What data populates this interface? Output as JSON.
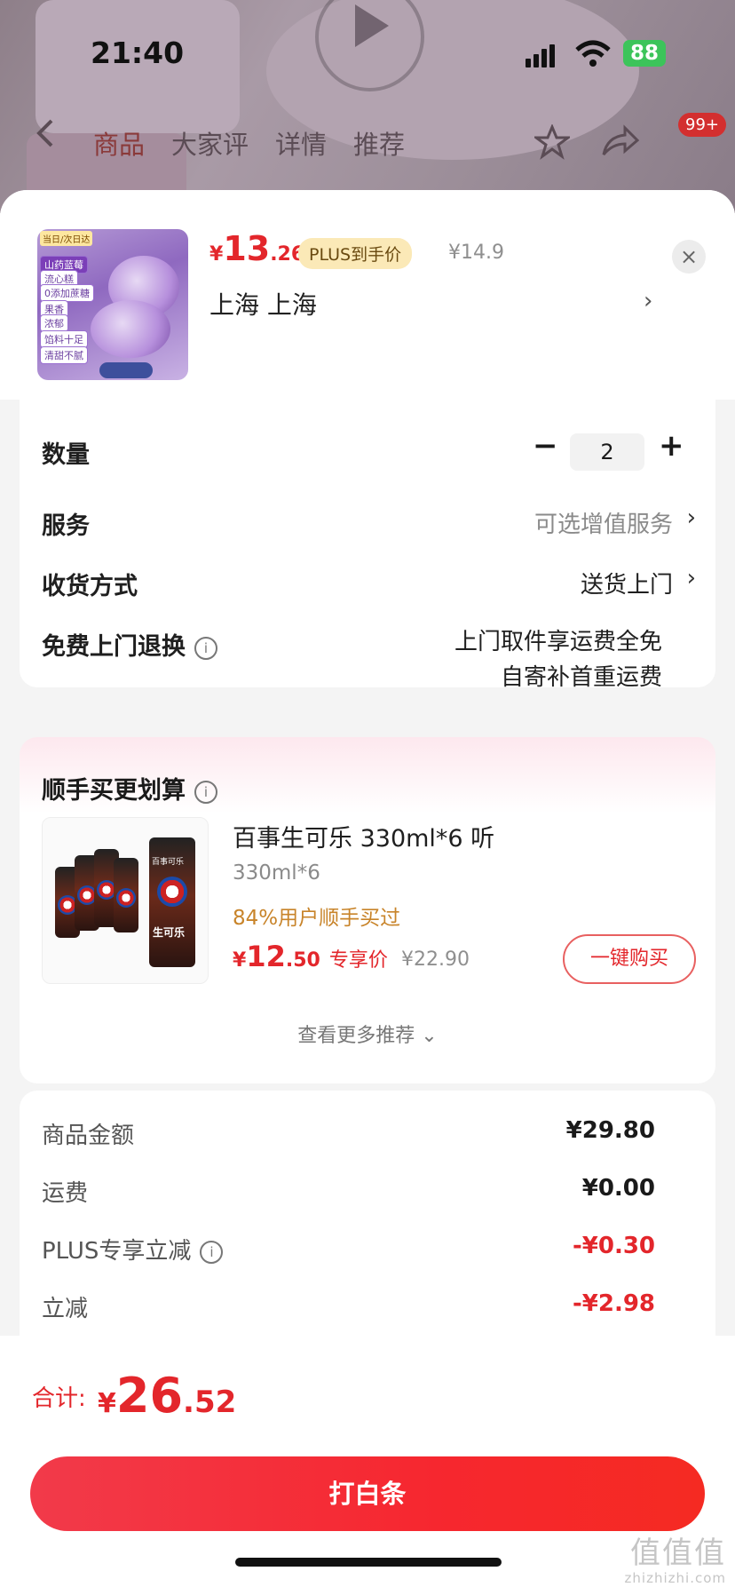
{
  "status_bar": {
    "time": "21:40",
    "battery": "88"
  },
  "background_page": {
    "tabs": [
      "商品",
      "大家评",
      "详情",
      "推荐"
    ],
    "badge": "99+"
  },
  "product": {
    "thumbnail_tags": [
      "当日/次日达",
      "山药蓝莓",
      "流心糕",
      "0添加蔗糖",
      "果香",
      "浓郁",
      "馅料十足",
      "清甜不腻"
    ],
    "price_symbol": "¥",
    "price_int": "13",
    "price_dec": ".26",
    "plus_tag": "PLUS到手价",
    "original_price": "¥14.9",
    "address": "上海  上海",
    "chevron": "›",
    "close": "×"
  },
  "options": {
    "quantity_label": "数量",
    "quantity_value": "2",
    "minus": "−",
    "plus": "+",
    "service_label": "服务",
    "service_value": "可选增值服务",
    "delivery_label": "收货方式",
    "delivery_value": "送货上门",
    "return_label": "免费上门退换",
    "return_line1": "上门取件享运费全免",
    "return_line2": "自寄补首重运费",
    "chevron": "›",
    "info": "i"
  },
  "upsell": {
    "title": "顺手买更划算",
    "can_labels": [
      "百事可乐",
      "生可乐"
    ],
    "item_name": "百事生可乐 330ml*6 听",
    "item_spec": "330ml*6",
    "item_stat": "84%用户顺手买过",
    "price_symbol": "¥",
    "price_int": "12",
    "price_dec": ".50",
    "price_label": "专享价",
    "original_price": "¥22.90",
    "buy_button": "一键购买",
    "more": "查看更多推荐 ⌄"
  },
  "summary": {
    "rows": [
      {
        "label": "商品金额",
        "value": "¥29.80"
      },
      {
        "label": "运费",
        "value": "¥0.00"
      },
      {
        "label": "PLUS专享立减",
        "value": "-¥0.30"
      },
      {
        "label": "立减",
        "value": "-¥2.98"
      }
    ]
  },
  "footer": {
    "total_label": "合计:",
    "total_symbol": "¥",
    "total_int": "26",
    "total_dec": ".52",
    "pay_button": "打白条"
  },
  "watermark": {
    "main": "值值值",
    "sub": "zhizhizhi.com"
  },
  "colors": {
    "accent_red": "#e3262b",
    "plus_gold": "#fbe9b7",
    "stat_orange": "#c8842a"
  },
  "icons": [
    "play-icon",
    "back-icon",
    "favorite-icon",
    "share-icon",
    "close-icon",
    "chevron-right-icon",
    "info-icon",
    "minus-icon",
    "plus-icon",
    "chevron-down-icon",
    "signal-icon",
    "wifi-icon",
    "battery-icon"
  ]
}
